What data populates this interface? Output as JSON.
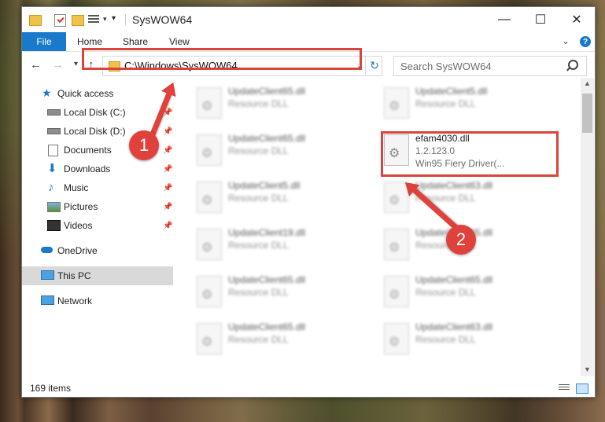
{
  "window": {
    "title": "SysWOW64"
  },
  "window_controls": {
    "minimize": "—",
    "maximize": "☐",
    "close": "✕"
  },
  "ribbon": {
    "tabs": [
      "File",
      "Home",
      "Share",
      "View"
    ],
    "help": "?"
  },
  "address": {
    "path": "C:\\Windows\\SysWOW64"
  },
  "search": {
    "placeholder": "Search SysWOW64"
  },
  "sidebar": {
    "items": [
      {
        "label": "Quick access",
        "icon": "star-icon"
      },
      {
        "label": "Local Disk (C:)",
        "icon": "drive-icon",
        "pinned": true
      },
      {
        "label": "Local Disk (D:)",
        "icon": "drive-icon",
        "pinned": true
      },
      {
        "label": "Documents",
        "icon": "documents-icon",
        "pinned": true
      },
      {
        "label": "Downloads",
        "icon": "downloads-icon",
        "pinned": true
      },
      {
        "label": "Music",
        "icon": "music-icon",
        "pinned": true
      },
      {
        "label": "Pictures",
        "icon": "pictures-icon",
        "pinned": true
      },
      {
        "label": "Videos",
        "icon": "videos-icon",
        "pinned": true
      },
      {
        "label": "OneDrive",
        "icon": "onedrive-icon"
      },
      {
        "label": "This PC",
        "icon": "pc-icon",
        "selected": true
      },
      {
        "label": "Network",
        "icon": "network-icon"
      }
    ]
  },
  "files": [
    {
      "name": "UpdateClient65.dll",
      "desc": "Resource DLL"
    },
    {
      "name": "UpdateClient5.dll",
      "desc": "Resource DLL"
    },
    {
      "name": "UpdateClient65.dll",
      "desc": "Resource DLL"
    },
    {
      "name": "efam4030.dll",
      "desc": "1.2.123.0",
      "desc2": "Win95 Fiery Driver(..."
    },
    {
      "name": "UpdateClient5.dll",
      "desc": "Resource DLL"
    },
    {
      "name": "UpdateClient63.dll",
      "desc": "Resource DLL"
    },
    {
      "name": "UpdateClient19.dll",
      "desc": "Resource DLL"
    },
    {
      "name": "UpdateClient65.dll",
      "desc": "Resource DLL"
    },
    {
      "name": "UpdateClient65.dll",
      "desc": "Resource DLL"
    },
    {
      "name": "UpdateClient65.dll",
      "desc": "Resource DLL"
    },
    {
      "name": "UpdateClient65.dll",
      "desc": "Resource DLL"
    },
    {
      "name": "UpdateClient63.dll",
      "desc": "Resource DLL"
    }
  ],
  "status": {
    "items": "169 items"
  },
  "annotations": {
    "step1": "1",
    "step2": "2",
    "color": "#e0413a"
  }
}
